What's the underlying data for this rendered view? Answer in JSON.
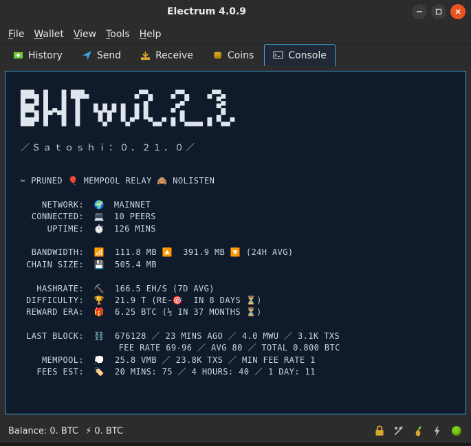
{
  "window": {
    "title": "Electrum 4.0.9"
  },
  "menu": {
    "file": "File",
    "wallet": "Wallet",
    "view": "View",
    "tools": "Tools",
    "help": "Help"
  },
  "tabs": {
    "history": "History",
    "send": "Send",
    "receive": "Receive",
    "coins": "Coins",
    "console": "Console"
  },
  "console": {
    "ascii_header": "███▄ █   █ ███▄          ▄▀▀▄    ▄▀▀▄    ▄▀▀▄\n█  █ █   █  █              ▄▀      ▄▀      ▀▄\n███  █ ▄ █  █   █ █ █ █  █ █     ▄▀        ▀▄\n█  █ █▀ ▀█  █    █ █  █  █ █       █       ▄▀\n███▀ █   █  █    ▀▄▀  ▀▄▀   ▀▄▄▀ █ ▀▄▄▄▄ █ ▀▄▄▀",
    "satoshi": "／Ｓａｔｏｓｈｉ：０．２１．０／",
    "flags_line": "✂ PRUNED 🎈 MEMPOOL RELAY 🙈 NOLISTEN",
    "network": {
      "label": "NETWORK:",
      "icon": "🌍",
      "value": "MAINNET"
    },
    "connected": {
      "label": "CONNECTED:",
      "icon": "💻",
      "value": "10 PEERS"
    },
    "uptime": {
      "label": "UPTIME:",
      "icon": "⏱️",
      "value": "126 MINS"
    },
    "bandwidth": {
      "label": "BANDWIDTH:",
      "text": "📶  111.8 MB 🔼  391.9 MB 🔽 (24H AVG)"
    },
    "chain_size": {
      "label": "CHAIN SIZE:",
      "text": "💾  505.4 MB"
    },
    "hashrate": {
      "label": "HASHRATE:",
      "text": "⛏️  166.5 EH/S (7D AVG)"
    },
    "difficulty": {
      "label": "DIFFICULTY:",
      "text": "🏆  21.9 T (RE-🎯  IN 8 DAYS ⏳)"
    },
    "reward": {
      "label": "REWARD ERA:",
      "text": "🎁  6.25 BTC (½ IN 37 MONTHS ⏳)"
    },
    "last_block": {
      "label": "LAST BLOCK:",
      "text": "⛓️  676128 ／ 23 MINS AGO ／ 4.0 MWU ／ 3.1K TXS"
    },
    "fee_line": "FEE RATE 69-96 ／ AVG 80 ／ TOTAL 0.800 BTC",
    "mempool": {
      "label": "MEMPOOL:",
      "text": "💭  25.8 VMB ／ 23.8K TXS ／ MIN FEE RATE 1"
    },
    "fees_est": {
      "label": "FEES EST:",
      "text": "🏷️  20 MINS: 75 ／ 4 HOURS: 40 ／ 1 DAY: 11"
    }
  },
  "status": {
    "balance": "Balance: 0. BTC",
    "lightning": "⚡ 0. BTC"
  }
}
